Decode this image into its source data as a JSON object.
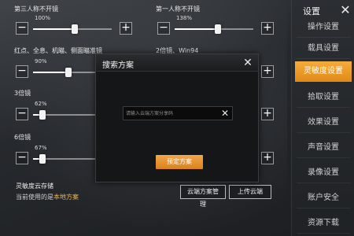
{
  "sliders": [
    {
      "title": "第三人称不开镜",
      "value_text": "100%",
      "level": 0.53
    },
    {
      "title": "第一人称不开镜",
      "value_text": "138%",
      "level": 0.55
    },
    {
      "title": "红点、全息、机瞄、侧面瞄准镜",
      "value_text": "90%",
      "level": 0.45
    },
    {
      "title": "2倍镜、Win94",
      "value_text": "",
      "level": 0.5
    },
    {
      "title": "3倍镜",
      "value_text": "62%",
      "level": 0.12
    },
    {
      "title": "",
      "value_text": "",
      "level": 0.5
    },
    {
      "title": "6倍镜",
      "value_text": "67%",
      "level": 0.12
    },
    {
      "title": "",
      "value_text": "",
      "level": 0.5
    }
  ],
  "buttons": {
    "minus": "−",
    "plus": "+"
  },
  "sidebar": {
    "title": "设置",
    "close": "✕",
    "items": [
      {
        "label": "操作设置"
      },
      {
        "label": "载具设置"
      },
      {
        "label": "灵敏度设置"
      },
      {
        "label": "拾取设置"
      },
      {
        "label": "效果设置"
      },
      {
        "label": "声音设置"
      },
      {
        "label": "录像设置"
      },
      {
        "label": "账户安全"
      },
      {
        "label": "资源下载"
      }
    ]
  },
  "cloud": {
    "title": "灵敏度云存储",
    "current_prefix": "当前使用的是",
    "current_value": "本地方案",
    "manage_button": "云端方案管理",
    "upload_button": "上传云端"
  },
  "modal": {
    "title": "搜索方案",
    "close": "✕",
    "input_placeholder": "请输入云端方案分享码",
    "input_clear": "✕",
    "confirm_button": "预定方案"
  },
  "colors": {
    "accent": "#F0A030",
    "highlight": "#F2B447"
  }
}
